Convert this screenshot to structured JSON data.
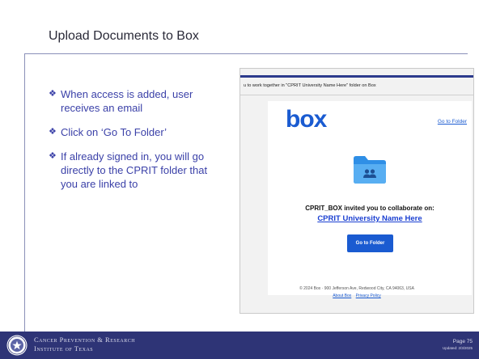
{
  "title": "Upload Documents to Box",
  "bullets": [
    "When access is added, user receives an email",
    "Click on ‘Go To Folder’",
    "If already signed in, you will go directly to the CPRIT folder that you are linked to"
  ],
  "email": {
    "subject": "u to work together in \"CPRIT University Name Here\" folder on Box",
    "logo": "box",
    "goto_link": "Go to Folder",
    "invite_text": "CPRIT_BOX invited you to collaborate on:",
    "folder_name": "CPRIT University Name Here",
    "button_label": "Go to Folder",
    "footer_address": "© 2024 Box · 900 Jefferson Ave, Redwood City, CA 94063, USA",
    "footer_link_about": "About Box",
    "footer_link_privacy": "Privacy Policy"
  },
  "footer": {
    "org_line1": "Cancer Prevention & Research",
    "org_line2": "Institute of Texas",
    "page": "Page 75",
    "updated": "Updated: 2/3/2025"
  },
  "colors": {
    "accent_blue": "#3b41a8",
    "box_blue": "#1a5bd1",
    "footer_navy": "#2e3476"
  },
  "icons": {
    "bullet": "diamond-bullet-icon",
    "folder": "shared-folder-icon",
    "seal": "texas-seal-icon"
  }
}
